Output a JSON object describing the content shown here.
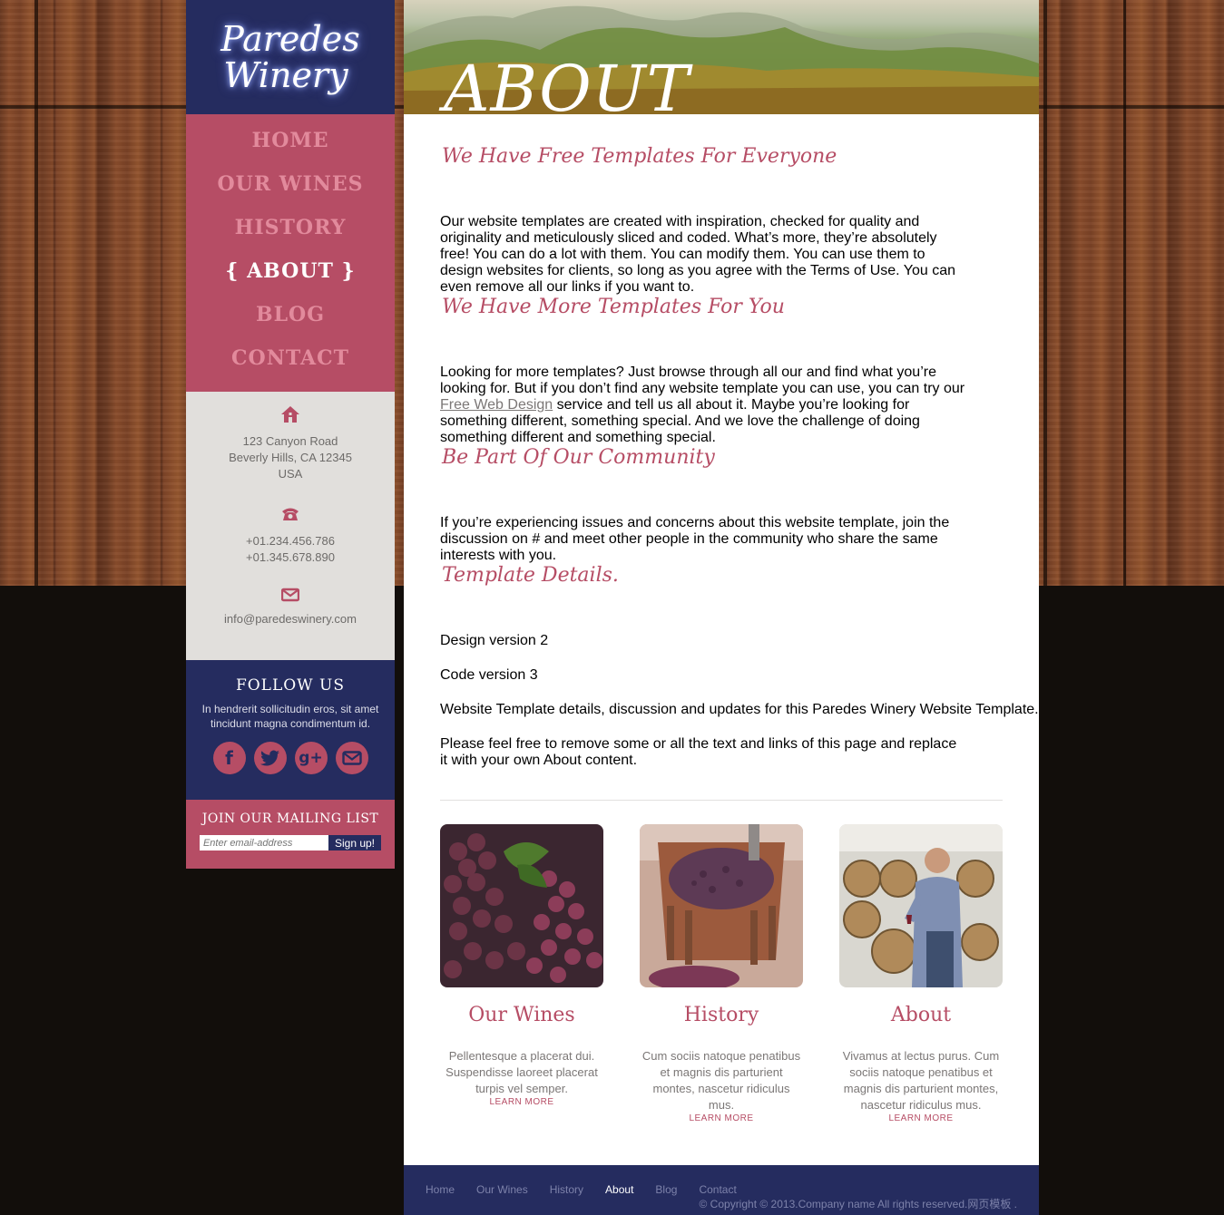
{
  "brand": {
    "line1": "Paredes",
    "line2": "Winery"
  },
  "nav": [
    {
      "label": "HOME",
      "active": false
    },
    {
      "label": "OUR WINES",
      "active": false
    },
    {
      "label": "HISTORY",
      "active": false
    },
    {
      "label": "{ ABOUT }",
      "active": true
    },
    {
      "label": "BLOG",
      "active": false
    },
    {
      "label": "CONTACT",
      "active": false
    }
  ],
  "contact": {
    "address": [
      "123 Canyon Road",
      "Beverly Hills, CA 12345",
      "USA"
    ],
    "phones": [
      "+01.234.456.786",
      "+01.345.678.890"
    ],
    "email": "info@paredeswinery.com"
  },
  "follow": {
    "title": "FOLLOW US",
    "text": "In hendrerit sollicitudin eros, sit amet tincidunt magna condimentum id.",
    "icons": [
      "facebook-icon",
      "twitter-icon",
      "google-plus-icon",
      "email-icon"
    ]
  },
  "mailing": {
    "title": "JOIN OUR MAILING LIST",
    "placeholder": "Enter email-address",
    "button": "Sign up!"
  },
  "page": {
    "title": "ABOUT",
    "sections": [
      {
        "heading": "We Have Free Templates For Everyone",
        "body": "Our website templates are created with inspiration, checked for quality and originality and meticulously sliced and coded. What’s more, they’re absolutely free! You can do a lot with them. You can modify them. You can use them to design websites for clients, so long as you agree with the Terms of Use. You can even remove all our links if you want to."
      },
      {
        "heading": "We Have More Templates For You",
        "body_before": "Looking for more templates? Just browse through all our and find what you’re looking for. But if you don’t find any website template you can use, you can try our ",
        "link": "Free Web Design",
        "body_after": " service and tell us all about it. Maybe you’re looking for something different, something special. And we love the challenge of doing something different and something special."
      },
      {
        "heading": "Be Part Of Our Community",
        "body": "If you’re experiencing issues and concerns about this website template, join the discussion on # and meet other people in the community who share the same interests with you."
      },
      {
        "heading": "Template Details.",
        "lines": [
          "Design version 2",
          "Code version 3",
          "Website Template details, discussion and updates for this Paredes Winery Website Template.",
          "Please feel free to remove some or all the text and links of this page and replace it with your own About content."
        ]
      }
    ]
  },
  "cards": [
    {
      "title": "Our Wines",
      "text": "Pellentesque a placerat dui. Suspendisse laoreet placerat turpis vel semper.",
      "link": "LEARN MORE"
    },
    {
      "title": "History",
      "text": "Cum sociis natoque penatibus et magnis dis parturient montes, nascetur ridiculus mus.",
      "link": "LEARN MORE"
    },
    {
      "title": "About",
      "text": "Vivamus at lectus purus. Cum sociis natoque penatibus et magnis dis parturient montes, nascetur ridiculus mus.",
      "link": "LEARN MORE"
    }
  ],
  "footer": {
    "nav": [
      {
        "label": "Home",
        "active": false
      },
      {
        "label": "Our Wines",
        "active": false
      },
      {
        "label": "History",
        "active": false
      },
      {
        "label": "About",
        "active": true
      },
      {
        "label": "Blog",
        "active": false
      },
      {
        "label": "Contact",
        "active": false
      }
    ],
    "copyright": "© Copyright © 2013.Company name All rights reserved.网页模板 ."
  },
  "colors": {
    "navy": "#252c5f",
    "rose": "#b64d65",
    "light_gray": "#e1dfdc",
    "text": "#7b7776"
  }
}
